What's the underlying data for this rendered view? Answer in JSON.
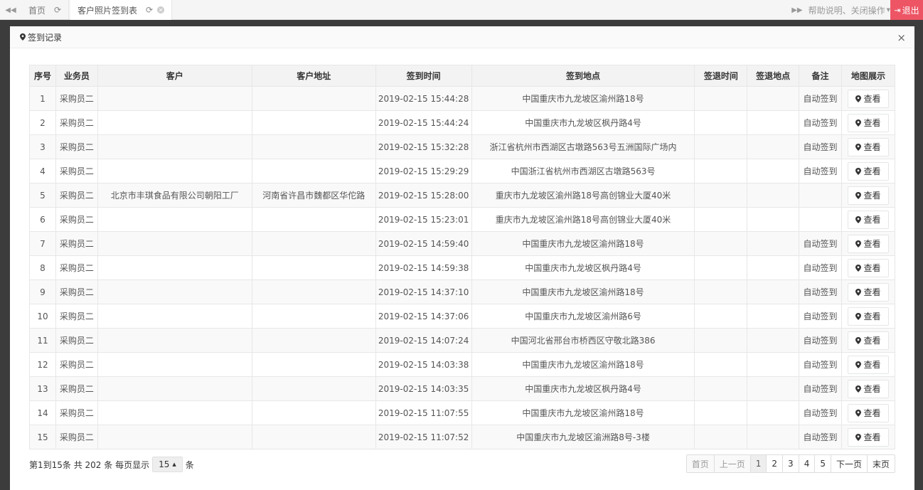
{
  "topbar": {
    "tabs": [
      {
        "label": "首页"
      },
      {
        "label": "客户照片签到表"
      }
    ],
    "help": "帮助说明、关闭操作",
    "logout": "退出"
  },
  "modal": {
    "title": "签到记录",
    "close": "×"
  },
  "table": {
    "headers": [
      "序号",
      "业务员",
      "客户",
      "客户地址",
      "签到时间",
      "签到地点",
      "签退时间",
      "签退地点",
      "备注",
      "地图展示"
    ],
    "view_label": "查看",
    "rows": [
      {
        "no": "1",
        "staff": "采购员二",
        "customer": "",
        "address": "",
        "time": "2019-02-15 15:44:28",
        "place": "中国重庆市九龙坡区渝州路18号",
        "out_time": "",
        "out_place": "",
        "note": "自动签到"
      },
      {
        "no": "2",
        "staff": "采购员二",
        "customer": "",
        "address": "",
        "time": "2019-02-15 15:44:24",
        "place": "中国重庆市九龙坡区枫丹路4号",
        "out_time": "",
        "out_place": "",
        "note": "自动签到"
      },
      {
        "no": "3",
        "staff": "采购员二",
        "customer": "",
        "address": "",
        "time": "2019-02-15 15:32:28",
        "place": "浙江省杭州市西湖区古墩路563号五洲国际广场内",
        "out_time": "",
        "out_place": "",
        "note": "自动签到"
      },
      {
        "no": "4",
        "staff": "采购员二",
        "customer": "",
        "address": "",
        "time": "2019-02-15 15:29:29",
        "place": "中国浙江省杭州市西湖区古墩路563号",
        "out_time": "",
        "out_place": "",
        "note": "自动签到"
      },
      {
        "no": "5",
        "staff": "采购员二",
        "customer": "北京市丰琪食品有限公司朝阳工厂",
        "address": "河南省许昌市魏都区华佗路",
        "time": "2019-02-15 15:28:00",
        "place": "重庆市九龙坡区渝州路18号高创锦业大厦40米",
        "out_time": "",
        "out_place": "",
        "note": ""
      },
      {
        "no": "6",
        "staff": "采购员二",
        "customer": "",
        "address": "",
        "time": "2019-02-15 15:23:01",
        "place": "重庆市九龙坡区渝州路18号高创锦业大厦40米",
        "out_time": "",
        "out_place": "",
        "note": ""
      },
      {
        "no": "7",
        "staff": "采购员二",
        "customer": "",
        "address": "",
        "time": "2019-02-15 14:59:40",
        "place": "中国重庆市九龙坡区渝州路18号",
        "out_time": "",
        "out_place": "",
        "note": "自动签到"
      },
      {
        "no": "8",
        "staff": "采购员二",
        "customer": "",
        "address": "",
        "time": "2019-02-15 14:59:38",
        "place": "中国重庆市九龙坡区枫丹路4号",
        "out_time": "",
        "out_place": "",
        "note": "自动签到"
      },
      {
        "no": "9",
        "staff": "采购员二",
        "customer": "",
        "address": "",
        "time": "2019-02-15 14:37:10",
        "place": "中国重庆市九龙坡区渝州路18号",
        "out_time": "",
        "out_place": "",
        "note": "自动签到"
      },
      {
        "no": "10",
        "staff": "采购员二",
        "customer": "",
        "address": "",
        "time": "2019-02-15 14:37:06",
        "place": "中国重庆市九龙坡区渝州路6号",
        "out_time": "",
        "out_place": "",
        "note": "自动签到"
      },
      {
        "no": "11",
        "staff": "采购员二",
        "customer": "",
        "address": "",
        "time": "2019-02-15 14:07:24",
        "place": "中国河北省邢台市桥西区守敬北路386",
        "out_time": "",
        "out_place": "",
        "note": "自动签到"
      },
      {
        "no": "12",
        "staff": "采购员二",
        "customer": "",
        "address": "",
        "time": "2019-02-15 14:03:38",
        "place": "中国重庆市九龙坡区渝州路18号",
        "out_time": "",
        "out_place": "",
        "note": "自动签到"
      },
      {
        "no": "13",
        "staff": "采购员二",
        "customer": "",
        "address": "",
        "time": "2019-02-15 14:03:35",
        "place": "中国重庆市九龙坡区枫丹路4号",
        "out_time": "",
        "out_place": "",
        "note": "自动签到"
      },
      {
        "no": "14",
        "staff": "采购员二",
        "customer": "",
        "address": "",
        "time": "2019-02-15 11:07:55",
        "place": "中国重庆市九龙坡区渝州路18号",
        "out_time": "",
        "out_place": "",
        "note": "自动签到"
      },
      {
        "no": "15",
        "staff": "采购员二",
        "customer": "",
        "address": "",
        "time": "2019-02-15 11:07:52",
        "place": "中国重庆市九龙坡区渝洲路8号-3楼",
        "out_time": "",
        "out_place": "",
        "note": "自动签到"
      }
    ]
  },
  "footer": {
    "info_prefix": "第1到15条 共 202 条 每页显示",
    "page_size": "15",
    "info_suffix": "条",
    "pager": [
      "首页",
      "上一页",
      "1",
      "2",
      "3",
      "4",
      "5",
      "下一页",
      "末页"
    ]
  }
}
